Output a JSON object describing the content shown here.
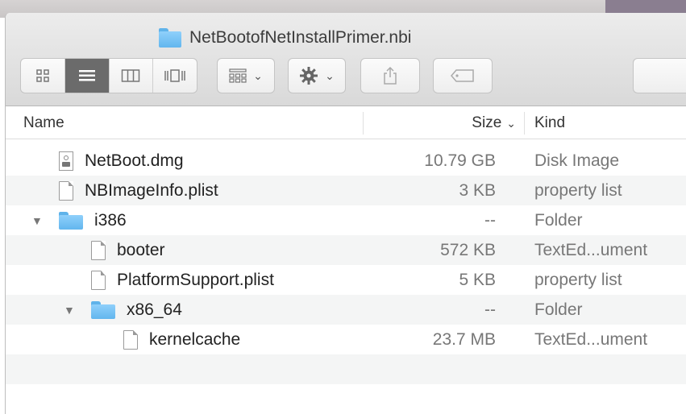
{
  "window": {
    "title": "NetBootofNetInstallPrimer.nbi"
  },
  "toolbar": {
    "view_buttons": [
      {
        "icon": "icon-view-icon",
        "active": false
      },
      {
        "icon": "list-view-icon",
        "active": true
      },
      {
        "icon": "column-view-icon",
        "active": false
      },
      {
        "icon": "cover-flow-icon",
        "active": false
      }
    ],
    "arrange_icon": "arrange-grid-icon",
    "action_icon": "gear-icon",
    "share_icon": "share-icon",
    "tag_icon": "tag-icon",
    "chevron": "⌄"
  },
  "columns": {
    "name": "Name",
    "size": "Size",
    "size_sort": "⌄",
    "kind": "Kind"
  },
  "files": [
    {
      "name": "NetBoot.dmg",
      "size": "10.79 GB",
      "kind": "Disk Image",
      "icon": "disk-image-icon",
      "depth": 0,
      "disclosure": ""
    },
    {
      "name": "NBImageInfo.plist",
      "size": "3 KB",
      "kind": "property list",
      "icon": "document-icon",
      "depth": 0,
      "disclosure": ""
    },
    {
      "name": "i386",
      "size": "--",
      "kind": "Folder",
      "icon": "folder-icon",
      "depth": 0,
      "disclosure": "▼"
    },
    {
      "name": "booter",
      "size": "572 KB",
      "kind": "TextEd...ument",
      "icon": "document-icon",
      "depth": 1,
      "disclosure": ""
    },
    {
      "name": "PlatformSupport.plist",
      "size": "5 KB",
      "kind": "property list",
      "icon": "document-icon",
      "depth": 1,
      "disclosure": ""
    },
    {
      "name": "x86_64",
      "size": "--",
      "kind": "Folder",
      "icon": "folder-icon",
      "depth": 1,
      "disclosure": "▼"
    },
    {
      "name": "kernelcache",
      "size": "23.7 MB",
      "kind": "TextEd...ument",
      "icon": "document-icon",
      "depth": 2,
      "disclosure": ""
    }
  ],
  "colors": {
    "folder": "#62b6ee",
    "active_view": "#6b6b6b",
    "row_alt": "#f4f5f5"
  }
}
